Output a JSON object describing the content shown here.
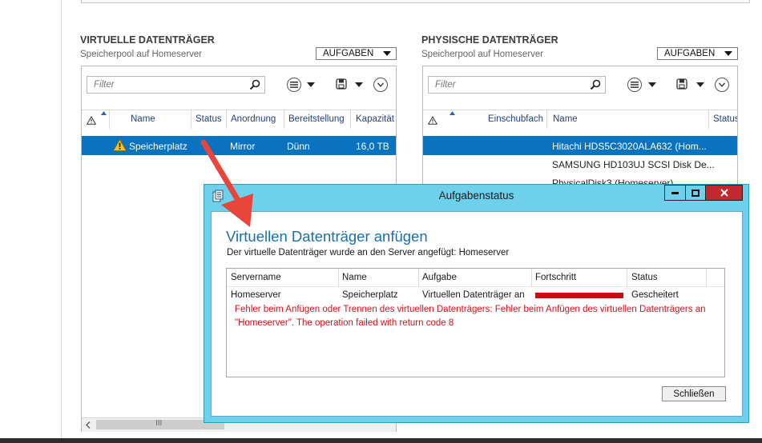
{
  "virtual": {
    "title": "VIRTUELLE DATENTRÄGER",
    "subtitle": "Speicherpool auf Homeserver",
    "tasks_label": "AUFGABEN",
    "filter_placeholder": "Filter",
    "columns": [
      "Name",
      "Status",
      "Anordnung",
      "Bereitstellung",
      "Kapazität"
    ],
    "rows": [
      {
        "name": "Speicherplatz",
        "status": "",
        "layout": "Mirror",
        "provisioning": "Dünn",
        "capacity": "16,0 TB",
        "warning": true,
        "selected": true
      }
    ],
    "scrollbar_thumb": "III"
  },
  "physical": {
    "title": "PHYSISCHE DATENTRÄGER",
    "subtitle": "Speicherpool auf Homeserver",
    "tasks_label": "AUFGABEN",
    "filter_placeholder": "Filter",
    "columns": [
      "Einschubfach",
      "Name",
      "Status"
    ],
    "rows": [
      {
        "name": "Hitachi HDS5C3020ALA632 (Hom...",
        "selected": true
      },
      {
        "name": "SAMSUNG HD103UJ SCSI Disk De...",
        "selected": false
      },
      {
        "name": "PhysicalDisk3 (Homeserver)",
        "selected": false
      }
    ]
  },
  "dialog": {
    "window_title": "Aufgabenstatus",
    "heading": "Virtuellen Datenträger anfügen",
    "description": "Der virtuelle Datenträger wurde an den Server angefügt: Homeserver",
    "columns": [
      "Servername",
      "Name",
      "Aufgabe",
      "Fortschritt",
      "Status"
    ],
    "row": {
      "server": "Homeserver",
      "name": "Speicherplatz",
      "task": "Virtuellen Datenträger an",
      "progress": 1.0,
      "status": "Gescheitert"
    },
    "error_line1": "Fehler beim Anfügen oder Trennen des virtuellen Datenträgers: Fehler beim Anfügen des virtuellen Datenträgers an",
    "error_line2": "\"Homeserver\". The operation failed with return code 8",
    "close_label": "Schließen"
  },
  "colors": {
    "selection": "#0a72bf",
    "dialog_frame": "#6fd0ec",
    "dialog_heading": "#1e6ea6",
    "error_text": "#d0121b",
    "progress_fill": "#c40f0f",
    "close_button": "#c1292e",
    "annotation_arrow": "#e8463a"
  }
}
